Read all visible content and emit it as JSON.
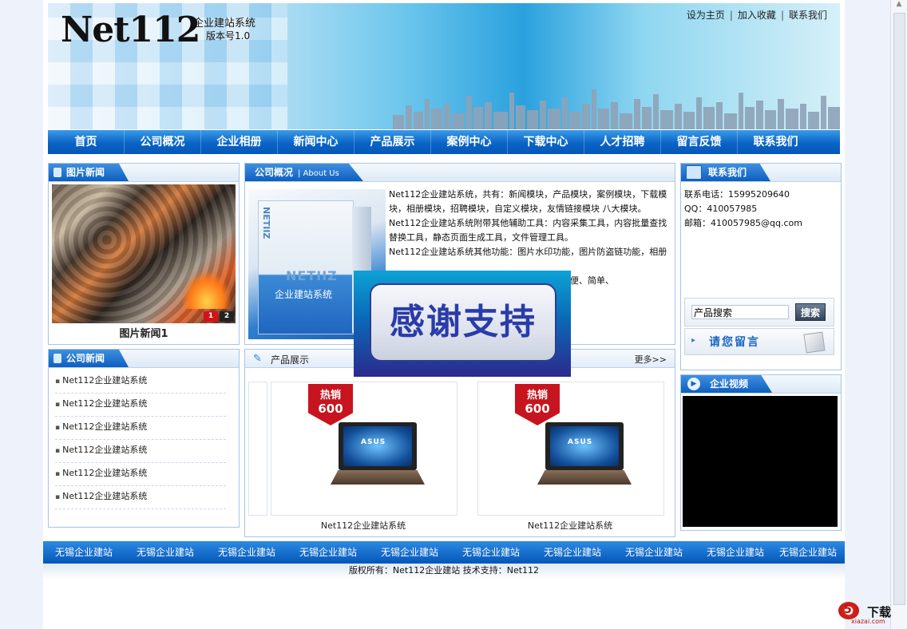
{
  "header": {
    "logo": "Net112",
    "logo_sub": "企业建站系统",
    "version": "版本号1.0",
    "top_links": [
      "设为主页",
      "加入收藏",
      "联系我们"
    ]
  },
  "nav": [
    "首页",
    "公司概况",
    "企业相册",
    "新闻中心",
    "产品展示",
    "案例中心",
    "下载中心",
    "人才招聘",
    "留言反馈",
    "联系我们"
  ],
  "picture_news": {
    "title": "图片新闻",
    "caption": "图片新闻1",
    "pager": [
      "1",
      "2"
    ]
  },
  "company_news": {
    "title": "公司新闻",
    "items": [
      "Net112企业建站系统",
      "Net112企业建站系统",
      "Net112企业建站系统",
      "Net112企业建站系统",
      "Net112企业建站系统",
      "Net112企业建站系统"
    ]
  },
  "about": {
    "title": "公司概况",
    "title_en": "| About Us",
    "product_brand": "NETIIZ",
    "product_sub": "企业建站系统",
    "paragraphs": [
      "Net112企业建站系统，共有：新闻模块，产品模块，案例模块，下载模块，相册模块，招聘模块，自定义模块，友情链接模块 八大模块。",
      "Net112企业建站系统附带其他辅助工具：内容采集工具，内容批量查找替换工具，静态页面生成工具，文件管理工具。",
      "Net112企业建站系统其他功能：图片水印功能，图片防盗链功能，相册",
      "块数据。方便、简单、"
    ]
  },
  "products": {
    "title": "产品展示",
    "more": "更多>>",
    "hot_label": "热销",
    "hot_number": "600",
    "laptop_brand": "ASUS",
    "items": [
      {
        "name": "Net112企业建站系统"
      },
      {
        "name": "Net112企业建站系统"
      }
    ]
  },
  "contact": {
    "title": "联系我们",
    "phone": "联系电话：15995209640",
    "qq": "QQ：410057985",
    "email": "邮箱：410057985@qq.com",
    "search_value": "产品搜索",
    "search_button": "搜索",
    "message_button": "请您留言"
  },
  "video": {
    "title": "企业视频"
  },
  "footer": {
    "links": [
      "无锡企业建站",
      "无锡企业建站",
      "无锡企业建站",
      "无锡企业建站",
      "无锡企业建站",
      "无锡企业建站",
      "无锡企业建站",
      "无锡企业建站",
      "无锡企业建站",
      "无锡企业建站"
    ],
    "copyright": "版权所有：Net112企业建站 技术支持：Net112"
  },
  "overlay": {
    "text": "感谢支持"
  },
  "watermark": {
    "brand": "5",
    "label": "下载",
    "url": "xiazai.com"
  },
  "colors": {
    "nav": "#0a63c6",
    "hot": "#c8141e",
    "overlay_text": "#2a3ca8"
  }
}
